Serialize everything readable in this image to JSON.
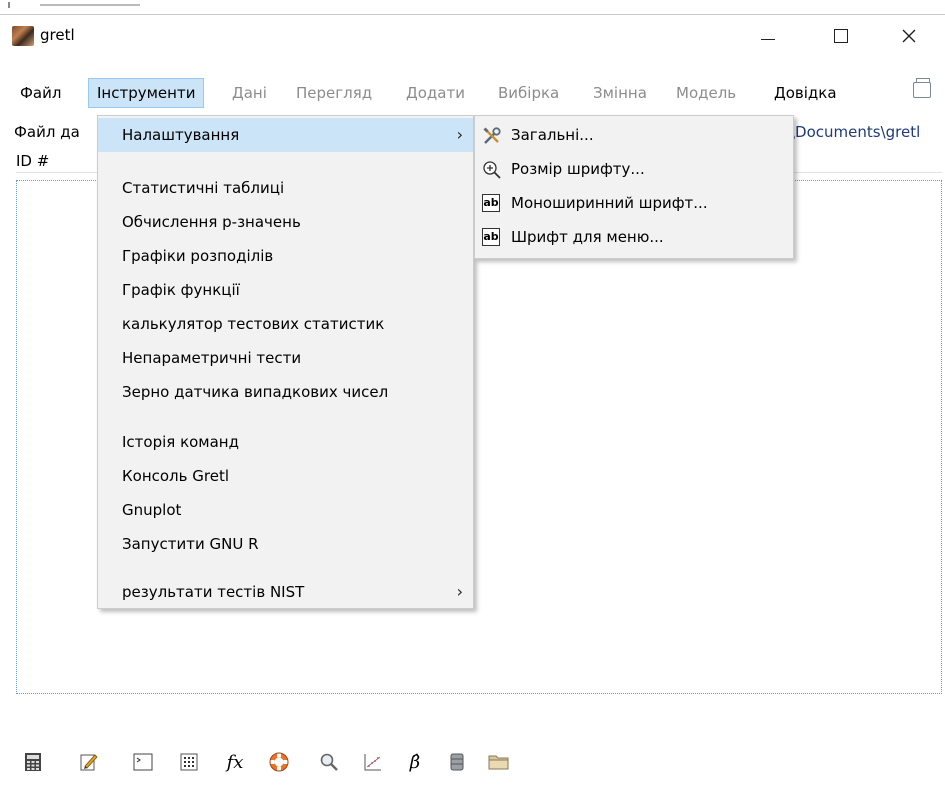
{
  "window": {
    "title": "gretl"
  },
  "window_controls": {
    "minimize": "—",
    "maximize": "☐",
    "close": "✕"
  },
  "menubar": {
    "items": [
      {
        "label": "Файл",
        "state": "normal"
      },
      {
        "label": "Інструменти",
        "state": "active"
      },
      {
        "label": "Дані",
        "state": "disabled"
      },
      {
        "label": "Перегляд",
        "state": "disabled"
      },
      {
        "label": "Додати",
        "state": "disabled"
      },
      {
        "label": "Вибірка",
        "state": "disabled"
      },
      {
        "label": "Змінна",
        "state": "disabled"
      },
      {
        "label": "Модель",
        "state": "disabled"
      },
      {
        "label": "Довідка",
        "state": "normal"
      }
    ]
  },
  "info": {
    "file_label": "Файл да",
    "path": "\\Documents\\gretl",
    "id_header": "ID #"
  },
  "tools_menu": {
    "items": [
      {
        "label": "Налаштування",
        "submenu": true,
        "highlighted": true
      },
      {
        "label": "Статистичні таблиці"
      },
      {
        "label": "Обчислення p-значень"
      },
      {
        "label": "Графіки розподілів"
      },
      {
        "label": "Графік функції"
      },
      {
        "label": "калькулятор тестових статистик"
      },
      {
        "label": "Непараметричні тести"
      },
      {
        "label": "Зерно датчика випадкових  чисел"
      },
      {
        "label": "Історія команд"
      },
      {
        "label": "Консоль Gretl"
      },
      {
        "label": "Gnuplot"
      },
      {
        "label": "Запустити GNU R"
      },
      {
        "label": "результати тестів NIST",
        "submenu": true
      }
    ],
    "arrow": "›"
  },
  "settings_submenu": {
    "items": [
      {
        "label": "Загальні...",
        "icon": "tools-icon"
      },
      {
        "label": "Розмір шрифту...",
        "icon": "zoom-in-icon"
      },
      {
        "label": "Моноширинний шрифт...",
        "icon": "font-icon"
      },
      {
        "label": "Шрифт для меню...",
        "icon": "font-icon"
      }
    ],
    "font_icon_text": "ab"
  },
  "toolbar": {
    "icons": [
      "calculator-icon",
      "edit-script-icon",
      "console-icon",
      "matrix-icon",
      "function-icon",
      "help-icon",
      "search-icon",
      "plot-icon",
      "beta-icon",
      "database-icon",
      "folder-icon"
    ],
    "fx_label": "fx",
    "beta_label": "β̂"
  }
}
